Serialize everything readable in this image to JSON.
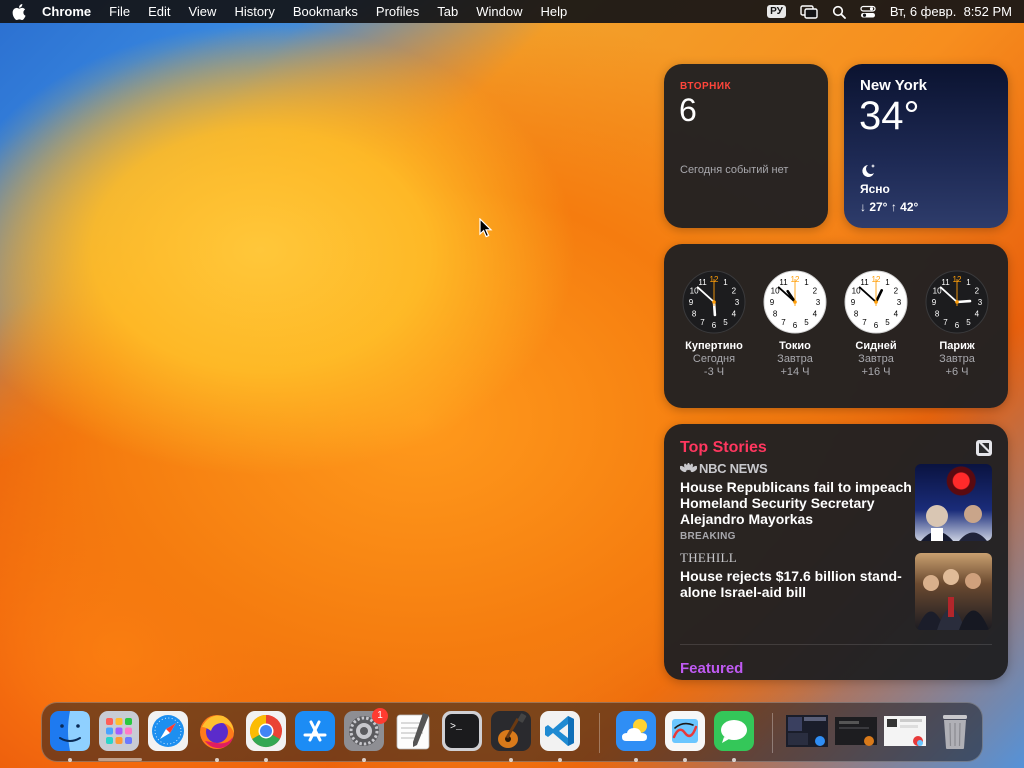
{
  "menubar": {
    "app": "Chrome",
    "items": [
      "File",
      "Edit",
      "View",
      "History",
      "Bookmarks",
      "Profiles",
      "Tab",
      "Window",
      "Help"
    ],
    "input_source": "РУ",
    "datetime": "Вт, 6 февр.  8:52 PM"
  },
  "widgets": {
    "calendar": {
      "weekday": "ВТОРНИК",
      "day": "6",
      "no_events": "Сегодня событий нет",
      "accent": "#ff453a"
    },
    "weather": {
      "city": "New York",
      "temperature": "34°",
      "condition": "Ясно",
      "low_high": "↓ 27° ↑ 42°",
      "icon": "moon-icon"
    },
    "world_clock": [
      {
        "city": "Купертино",
        "day": "Сегодня",
        "offset": "-3 Ч",
        "face": "dark",
        "hour": 5,
        "minute": 52
      },
      {
        "city": "Токио",
        "day": "Завтра",
        "offset": "+14 Ч",
        "face": "light",
        "hour": 10,
        "minute": 52
      },
      {
        "city": "Сидней",
        "day": "Завтра",
        "offset": "+16 Ч",
        "face": "light",
        "hour": 12,
        "minute": 52
      },
      {
        "city": "Париж",
        "day": "Завтра",
        "offset": "+6 Ч",
        "face": "dark",
        "hour": 2,
        "minute": 52
      }
    ],
    "news": {
      "title": "Top Stories",
      "story1": {
        "source": "NBC NEWS",
        "headline": "House Republicans fail to impeach Homeland Security Secretary Alejandro Mayorkas",
        "tag": "BREAKING"
      },
      "story2": {
        "source": "THEHILL",
        "headline": "House rejects $17.6 billion stand-alone Israel-aid bill"
      },
      "featured": "Featured",
      "accent": "#ff375f"
    }
  },
  "dock": {
    "apps": [
      {
        "name": "finder-icon",
        "running": true
      },
      {
        "name": "launchpad-icon",
        "running": true
      },
      {
        "name": "safari-icon",
        "running": true
      },
      {
        "name": "firefox-icon",
        "running": true
      },
      {
        "name": "chrome-icon",
        "running": true
      },
      {
        "name": "app-store-icon",
        "running": false
      },
      {
        "name": "system-settings-icon",
        "running": true,
        "badge": "1"
      },
      {
        "name": "textedit-icon",
        "running": false
      },
      {
        "name": "terminal-icon",
        "running": false
      },
      {
        "name": "garageband-icon",
        "running": true
      },
      {
        "name": "vscode-icon",
        "running": true
      },
      {
        "name": "weather-app-icon",
        "running": true
      },
      {
        "name": "freeform-icon",
        "running": true
      },
      {
        "name": "messages-icon",
        "running": true
      },
      {
        "name": "trash-icon",
        "running": false
      }
    ]
  }
}
